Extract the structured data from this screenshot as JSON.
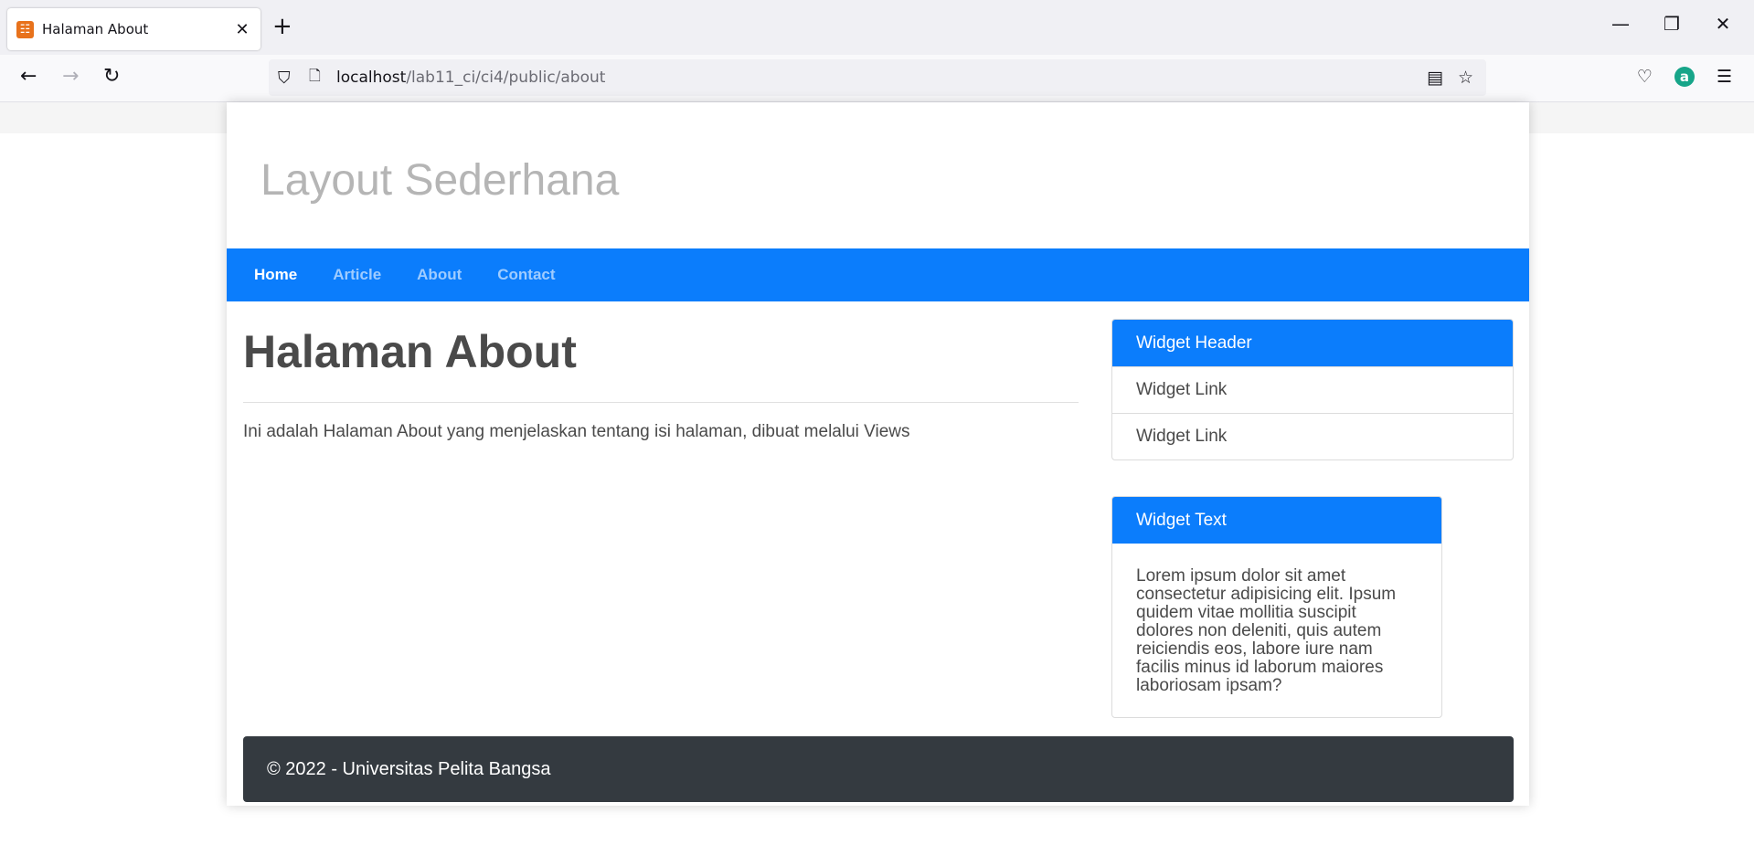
{
  "browser": {
    "tab_title": "Halaman About",
    "tab_close": "✕",
    "new_tab": "+",
    "url_host": "localhost",
    "url_path": "/lab11_ci/ci4/public/about",
    "win_minimize": "—",
    "win_restore": "❐",
    "win_close": "✕",
    "back": "←",
    "forward": "→",
    "reload": "↻",
    "ext_letter": "a"
  },
  "site": {
    "title": "Layout Sederhana",
    "nav": [
      {
        "label": "Home",
        "active": true
      },
      {
        "label": "Article",
        "active": false
      },
      {
        "label": "About",
        "active": false
      },
      {
        "label": "Contact",
        "active": false
      }
    ]
  },
  "main": {
    "heading": "Halaman About",
    "text": "Ini adalah Halaman About yang menjelaskan tentang isi halaman, dibuat melalui Views"
  },
  "sidebar": {
    "widget1": {
      "header": "Widget Header",
      "links": [
        "Widget Link",
        "Widget Link"
      ]
    },
    "widget2": {
      "header": "Widget Text",
      "body": "Lorem ipsum dolor sit amet consectetur adipisicing elit. Ipsum quidem vitae mollitia suscipit dolores non deleniti, quis autem reiciendis eos, labore iure nam facilis minus id laborum maiores laboriosam ipsam?"
    }
  },
  "footer": {
    "text": "© 2022 - Universitas Pelita Bangsa"
  },
  "colors": {
    "primary": "#0b7dfc",
    "footer_bg": "#343a40",
    "title_gray": "#b5b5b5"
  }
}
